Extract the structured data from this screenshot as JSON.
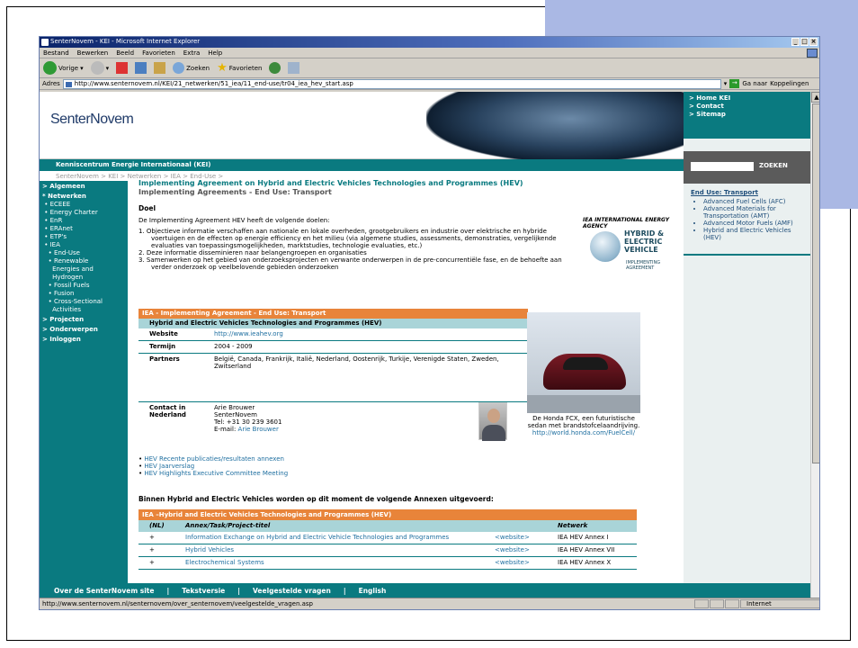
{
  "window": {
    "title": "SenterNovem - KEI - Microsoft Internet Explorer"
  },
  "menu": [
    "Bestand",
    "Bewerken",
    "Beeld",
    "Favorieten",
    "Extra",
    "Help"
  ],
  "toolbar": {
    "back": "Vorige",
    "search": "Zoeken",
    "favorites": "Favorieten"
  },
  "address": {
    "label": "Adres",
    "url": "http://www.senternovem.nl/KEI/21_netwerken/51_iea/11_end-use/tr04_iea_hev_start.asp",
    "go": "Ga naar",
    "links": "Koppelingen"
  },
  "site": {
    "brand": "SenterNovem",
    "kei": "Kenniscentrum Energie Internationaal (KEI)",
    "breadcrumb": "SenterNovem > KEI > Netwerken > IEA > End-Use >",
    "top_links": [
      "> Home KEI",
      "> Contact",
      "> Sitemap"
    ],
    "search_button": "ZOEKEN"
  },
  "leftnav": [
    {
      "label": "> Algemeen",
      "top": true
    },
    {
      "label": "* Netwerken",
      "top": true
    },
    {
      "label": " • ECEEE"
    },
    {
      "label": " • Energy Charter"
    },
    {
      "label": " • EnR"
    },
    {
      "label": " • ERAnet"
    },
    {
      "label": " • ETP's"
    },
    {
      "label": " • IEA"
    },
    {
      "label": "   • End-Use"
    },
    {
      "label": "   • Renewable\n     Energies and\n     Hydrogen"
    },
    {
      "label": "   • Fossil Fuels"
    },
    {
      "label": "   • Fusion"
    },
    {
      "label": "   • Cross-Sectional\n     Activities"
    },
    {
      "label": "> Projecten",
      "top": true
    },
    {
      "label": "> Onderwerpen",
      "top": true
    },
    {
      "label": "> Inloggen",
      "top": true
    }
  ],
  "right": {
    "title": "End Use: Transport",
    "items": [
      "Advanced Fuel Cells (AFC)",
      "Advanced Materials for Transportation (AMT)",
      "Advanced Motor Fuels (AMF)",
      "Hybrid and Electric Vehicles (HEV)"
    ]
  },
  "main": {
    "h1": "Implementing Agreement on Hybrid and Electric Vehicles Technologies and Programmes (HEV)",
    "h2": "Implementing Agreements - End Use: Transport",
    "doel": "Doel",
    "intro": "De Implementing Agreement HEV heeft de volgende doelen:",
    "goals": [
      "1.  Objectieve informatie verschaffen aan nationale en lokale overheden, grootgebruikers en industrie over elektrische en hybride voertuigen en de effecten op energie efficiency en het milieu (via algemene studies, assessments, demonstraties, vergelijkende evaluaties van toepassingsmogelijkheden, marktstudies, technologie evaluaties, etc.)",
      "2.  Deze informatie disseminieren naar belangengroepen en organisaties",
      "3.  Samenwerken op het gebied van onderzoeksprojecten en verwante onderwerpen in de pre-concurrentiële fase, en de behoefte aan verder onderzoek op veelbelovende gebieden onderzoeken"
    ],
    "logo": {
      "agency": "IEA INTERNATIONAL ENERGY AGENCY",
      "line1": "HYBRID &",
      "line2": "ELECTRIC",
      "line3": "VEHICLE",
      "line4": "IMPLEMENTING AGREEMENT"
    },
    "table": {
      "head": "IEA - Implementing Agreement - End Use: Transport",
      "sub": "Hybrid and Electric Vehicles Technologies and Programmes (HEV)",
      "website_label": "Website",
      "website": "http://www.ieahev.org",
      "termijn_label": "Termijn",
      "termijn": "2004 - 2009",
      "partners_label": "Partners",
      "partners": "België, Canada, Frankrijk, Italië, Nederland, Oostenrijk, Turkije, Verenigde Staten, Zweden, Zwitserland",
      "contact_label": "Contact in Nederland",
      "contact": [
        "Arie Brouwer",
        "SenterNovem",
        "Tel: +31 30 239 3601"
      ],
      "email_prefix": "E-mail: ",
      "email": "Arie Brouwer"
    },
    "caption": "De Honda FCX, een futuristische sedan met brandstofcelaandrijving.",
    "caption_link": "http://world.honda.com/FuelCell/",
    "bullets": [
      "HEV Recente publicaties/resultaten annexen",
      "HEV Jaarverslag",
      "HEV Highlights Executive Committee Meeting"
    ],
    "annex_intro": "Binnen Hybrid and Electric Vehicles worden op dit moment de volgende Annexen uitgevoerd:",
    "annex": {
      "head": "IEA –Hybrid and Electric Vehicles Technologies and Programmes (HEV)",
      "cols": [
        "(NL)",
        "Annex/Task/Project-titel",
        "",
        "Netwerk"
      ],
      "rows": [
        {
          "nl": "+",
          "title": "Information Exchange on Hybrid and Electric Vehicle Technologies and Programmes",
          "web": "<website>",
          "net": "IEA HEV Annex I"
        },
        {
          "nl": "+",
          "title": "Hybrid Vehicles",
          "web": "<website>",
          "net": "IEA HEV Annex VII"
        },
        {
          "nl": "+",
          "title": "Electrochemical Systems",
          "web": "<website>",
          "net": "IEA HEV Annex X"
        }
      ]
    }
  },
  "footer": [
    "Over de SenterNovem site",
    "|",
    "Tekstversie",
    "|",
    "Veelgestelde vragen",
    "|",
    "English"
  ],
  "status": {
    "url": "http://www.senternovem.nl/senternovem/over_senternovem/veelgestelde_vragen.asp",
    "zone": "Internet"
  }
}
